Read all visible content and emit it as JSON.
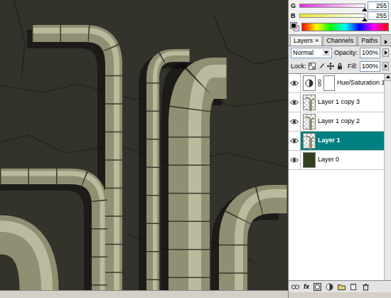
{
  "color_panel": {
    "channels": [
      {
        "label": "G",
        "value": "255",
        "level": 1.0,
        "color": "#e030e0"
      },
      {
        "label": "B",
        "value": "255",
        "level": 1.0,
        "color": "#e8e830"
      }
    ]
  },
  "layers_panel": {
    "tabs": [
      {
        "label": "Layers",
        "selected": true,
        "close": "×"
      },
      {
        "label": "Channels",
        "selected": false,
        "close": ""
      },
      {
        "label": "Paths",
        "selected": false,
        "close": ""
      }
    ],
    "blend_mode": "Normal",
    "opacity_label": "Opacity:",
    "opacity": "100%",
    "lock_label": "Lock:",
    "fill_label": "Fill:",
    "fill": "100%",
    "layers": [
      {
        "name": "Hue/Saturation 1",
        "visible": true,
        "selected": false,
        "kind": "adjustment"
      },
      {
        "name": "Layer 1 copy 3",
        "visible": true,
        "selected": false,
        "kind": "transparent"
      },
      {
        "name": "Layer 1 copy 2",
        "visible": true,
        "selected": false,
        "kind": "transparent"
      },
      {
        "name": "Layer 1",
        "visible": true,
        "selected": true,
        "kind": "transparent"
      },
      {
        "name": "Layer 0",
        "visible": true,
        "selected": false,
        "kind": "filled"
      }
    ],
    "fx_label": "fx"
  }
}
